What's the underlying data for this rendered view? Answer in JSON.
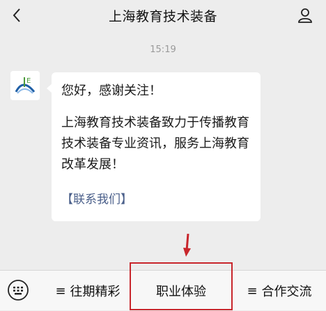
{
  "header": {
    "title": "上海教育技术装备",
    "back_icon": "chevron-left-icon",
    "profile_icon": "person-icon"
  },
  "chat": {
    "timestamp": "15:19",
    "message": {
      "greeting": "您好，感谢关注！",
      "body": "上海教育技术装备致力于传播教育技术装备专业资讯，服务上海教育改革发展！",
      "link": "【联系我们】"
    },
    "avatar_logo_letter": "E"
  },
  "bottom_menu": {
    "keyboard_icon": "keyboard-icon",
    "items": [
      {
        "icon": "≡",
        "label": "往期精彩"
      },
      {
        "icon": "",
        "label": "职业体验"
      },
      {
        "icon": "≡",
        "label": "合作交流"
      }
    ]
  },
  "annotation": {
    "highlight_color": "#c8262c",
    "arrow_color": "#c8262c"
  }
}
